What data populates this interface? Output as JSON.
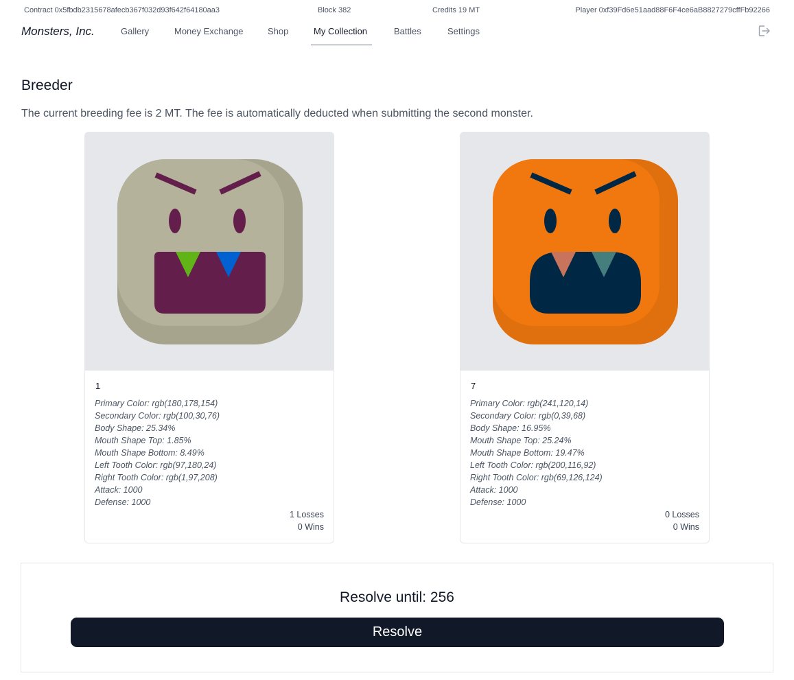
{
  "infobar": {
    "contract": "Contract 0x5fbdb2315678afecb367f032d93f642f64180aa3",
    "block": "Block 382",
    "credits": "Credits 19 MT",
    "player": "Player 0xf39Fd6e51aad88F6F4ce6aB8827279cffFb92266"
  },
  "nav": {
    "brand": "Monsters, Inc.",
    "items": [
      "Gallery",
      "Money Exchange",
      "Shop",
      "My Collection",
      "Battles",
      "Settings"
    ],
    "active": "My Collection",
    "logout_icon": "logout-icon"
  },
  "page": {
    "title": "Breeder",
    "description": "The current breeding fee is 2 MT. The fee is automatically deducted when submitting the second monster."
  },
  "monsters": [
    {
      "id": "1",
      "traits": [
        "Primary Color: rgb(180,178,154)",
        "Secondary Color: rgb(100,30,76)",
        "Body Shape: 25.34%",
        "Mouth Shape Top: 1.85%",
        "Mouth Shape Bottom: 8.49%",
        "Left Tooth Color: rgb(97,180,24)",
        "Right Tooth Color: rgb(1,97,208)",
        "Attack: 1000",
        "Defense: 1000"
      ],
      "losses": "1 Losses",
      "wins": "0 Wins",
      "colors": {
        "primary": "#b4b29a",
        "shade": "#a6a48c",
        "secondary": "#641e4c",
        "left_tooth": "#61b418",
        "right_tooth": "#0161d0"
      },
      "body_shape": 0.2534,
      "mouth_top": 0.0185,
      "mouth_bottom": 0.0849
    },
    {
      "id": "7",
      "traits": [
        "Primary Color: rgb(241,120,14)",
        "Secondary Color: rgb(0,39,68)",
        "Body Shape: 16.95%",
        "Mouth Shape Top: 25.24%",
        "Mouth Shape Bottom: 19.47%",
        "Left Tooth Color: rgb(200,116,92)",
        "Right Tooth Color: rgb(69,126,124)",
        "Attack: 1000",
        "Defense: 1000"
      ],
      "losses": "0 Losses",
      "wins": "0 Wins",
      "colors": {
        "primary": "#f1780e",
        "shade": "#e0700d",
        "secondary": "#002744",
        "left_tooth": "#c8745c",
        "right_tooth": "#457e7c"
      },
      "body_shape": 0.1695,
      "mouth_top": 0.2524,
      "mouth_bottom": 0.1947
    }
  ],
  "resolve": {
    "label": "Resolve until: 256",
    "button": "Resolve"
  }
}
